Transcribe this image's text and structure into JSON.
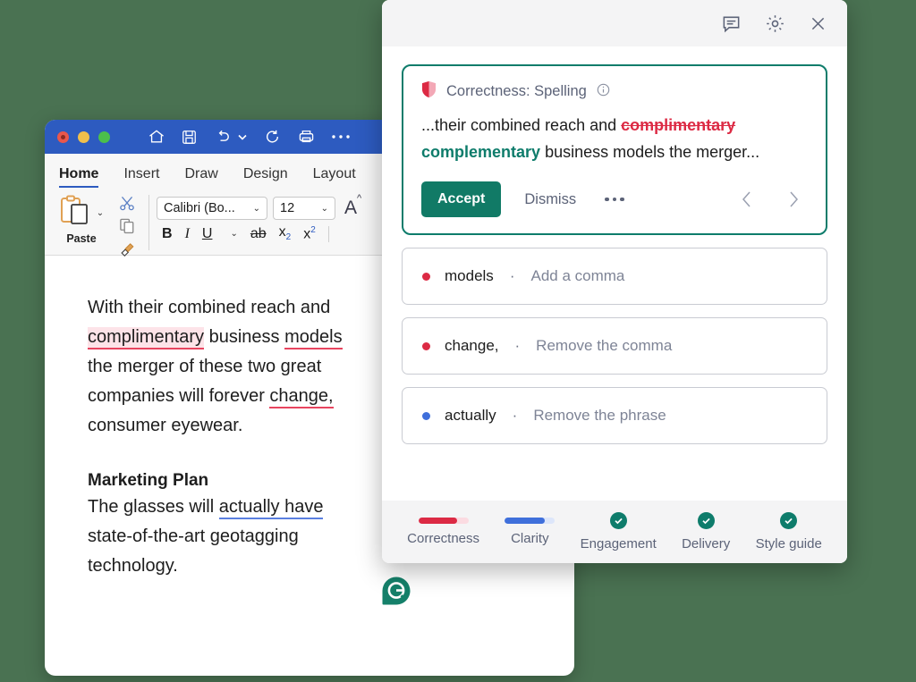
{
  "colors": {
    "background": "#4a7252",
    "word_titlebar": "#2d5bc0",
    "grammarly_green": "#0e7c6b",
    "accept_button": "#117a66",
    "error_red": "#dc2a44",
    "clarity_blue": "#3f6fdb",
    "highlight_pink": "#fde3e8"
  },
  "word_window": {
    "titlebar": {
      "traffic_lights": [
        "close",
        "minimize",
        "maximize"
      ],
      "icons": [
        "home-icon",
        "save-icon",
        "undo-icon",
        "undo-dropdown-icon",
        "redo-icon",
        "print-icon",
        "more-icon"
      ]
    },
    "ribbon_tabs": [
      {
        "label": "Home",
        "active": true
      },
      {
        "label": "Insert",
        "active": false
      },
      {
        "label": "Draw",
        "active": false
      },
      {
        "label": "Design",
        "active": false
      },
      {
        "label": "Layout",
        "active": false
      }
    ],
    "clipboard_group": {
      "paste_label": "Paste",
      "icons": [
        "paste-icon",
        "paste-dropdown-icon",
        "cut-scissors-icon",
        "copy-icon",
        "format-painter-icon"
      ]
    },
    "font_group": {
      "font_name": "Calibri (Bo...",
      "font_size": "12",
      "grow_font_label": "A",
      "buttons": [
        {
          "name": "bold",
          "label": "B"
        },
        {
          "name": "italic",
          "label": "I"
        },
        {
          "name": "underline",
          "label": "U"
        },
        {
          "name": "underline-dropdown",
          "label": "v"
        },
        {
          "name": "strikethrough",
          "label": "ab"
        },
        {
          "name": "subscript",
          "label": "x",
          "script": "2"
        },
        {
          "name": "superscript",
          "label": "x",
          "script": "2"
        }
      ]
    },
    "document": {
      "paragraph1": {
        "part1": "With their combined reach and ",
        "error_word": "complimentary",
        "part2": " business ",
        "error_word2": "models",
        "part3": " the merger of these two great companies will forever ",
        "error_word3": "change,",
        "part4": " consumer eyewear."
      },
      "heading": "Marketing Plan",
      "paragraph2": {
        "part1": "The glasses will ",
        "clarity_phrase": "actually have",
        "part2": " state-of-the-art geotagging technology."
      }
    }
  },
  "grammarly_panel": {
    "header_icons": [
      {
        "name": "comment-icon",
        "label": "Comments"
      },
      {
        "name": "gear-icon",
        "label": "Settings"
      },
      {
        "name": "close-icon",
        "label": "Close"
      }
    ],
    "card": {
      "category_icon": "shield-icon",
      "title": "Correctness: Spelling",
      "info_icon": "info-icon",
      "text_before": "...their combined reach and ",
      "text_struck": "complimentary",
      "text_replacement": "complementary",
      "text_after": " business models the merger...",
      "accept_label": "Accept",
      "dismiss_label": "Dismiss",
      "more_label": "More options",
      "prev_label": "Previous suggestion",
      "next_label": "Next suggestion"
    },
    "suggestions": [
      {
        "word": "models",
        "separator": "·",
        "action": "Add a comma",
        "dot": "red"
      },
      {
        "word": "change,",
        "separator": "·",
        "action": "Remove the comma",
        "dot": "red"
      },
      {
        "word": "actually",
        "separator": "·",
        "action": "Remove the phrase",
        "dot": "blue"
      }
    ],
    "footer_tabs": [
      {
        "label": "Correctness",
        "indicator": "bar-red"
      },
      {
        "label": "Clarity",
        "indicator": "bar-blue"
      },
      {
        "label": "Engagement",
        "indicator": "check"
      },
      {
        "label": "Delivery",
        "indicator": "check"
      },
      {
        "label": "Style guide",
        "indicator": "check"
      }
    ]
  },
  "grammarly_logo": {
    "name": "grammarly-logo",
    "letter": "G"
  }
}
